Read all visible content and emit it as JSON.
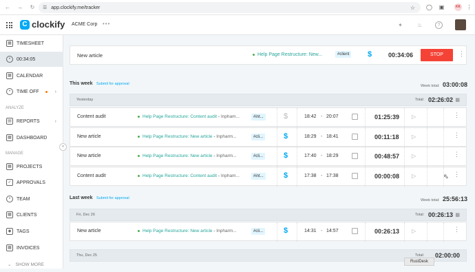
{
  "browser": {
    "url": "app.clockify.me/tracker",
    "profile": "KK"
  },
  "app": {
    "brand": "clockify",
    "workspace": "ACME Corp"
  },
  "sidebar": {
    "timesheet": "TIMESHEET",
    "timer": "00:34:05",
    "calendar": "CALENDAR",
    "time_off": "TIME OFF",
    "analyze_header": "ANALYZE",
    "reports": "REPORTS",
    "dashboard": "DASHBOARD",
    "manage_header": "MANAGE",
    "projects": "PROJECTS",
    "approvals": "APPROVALS",
    "team": "TEAM",
    "clients": "CLIENTS",
    "tags": "TAGS",
    "invoices": "INVOICES",
    "show_more": "SHOW MORE"
  },
  "timer": {
    "description": "New article",
    "project": "Help Page Restructure: New...",
    "tag": "#client",
    "billable_symbol": "$",
    "elapsed": "00:34:06",
    "stop_label": "STOP"
  },
  "this_week": {
    "label": "This week",
    "submit": "Submit for approval",
    "total_label": "Week total:",
    "total": "03:00:08"
  },
  "yesterday": {
    "label": "Yesterday",
    "total_label": "Total:",
    "total": "02:26:02"
  },
  "entries_yesterday": [
    {
      "description": "Content audit",
      "project": "Help Page Restructure: Content audit",
      "client": "Inpham...",
      "tag": "#int...",
      "billable": false,
      "start": "18:42",
      "end": "20:07",
      "duration": "01:25:39"
    },
    {
      "description": "New article",
      "project": "Help Page Restructure: New article",
      "client": "Inpharm...",
      "tag": "#cli...",
      "billable": true,
      "start": "18:29",
      "end": "18:41",
      "duration": "00:11:18"
    },
    {
      "description": "New article",
      "project": "Help Page Restructure: New article",
      "client": "Inpharm...",
      "tag": "#cli...",
      "billable": true,
      "start": "17:40",
      "end": "18:29",
      "duration": "00:48:57"
    },
    {
      "description": "Content audit",
      "project": "Help Page Restructure: Content audit",
      "client": "Inpham...",
      "tag": "#int...",
      "billable": true,
      "start": "17:38",
      "end": "17:38",
      "duration": "00:00:08"
    }
  ],
  "last_week": {
    "label": "Last week",
    "submit": "Submit for approval",
    "total_label": "Week total:",
    "total": "25:56:13"
  },
  "fri": {
    "label": "Fri, Dec 26",
    "total_label": "Total:",
    "total": "00:26:13"
  },
  "entries_fri": [
    {
      "description": "New article",
      "project": "Help Page Restructure: New article",
      "client": "Inpharm...",
      "tag": "#cli...",
      "billable": true,
      "start": "14:31",
      "end": "14:57",
      "duration": "00:26:13"
    }
  ],
  "thu": {
    "label": "Thu, Dec 25",
    "total_label": "Total:",
    "total": "02:00:00"
  },
  "dash": "-",
  "overlay": {
    "rustdesk": "RustDesk"
  }
}
